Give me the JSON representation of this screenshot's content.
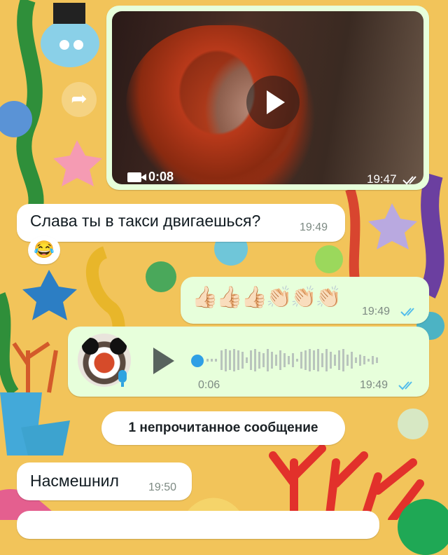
{
  "theme": {
    "out_bubble": "#e7ffdb",
    "in_bubble": "#ffffff",
    "read_ticks": "#53bdeb",
    "voice_progress": "#2f9fe5"
  },
  "forward": {
    "icon": "forward-arrow-icon"
  },
  "messages": {
    "video": {
      "duration": "0:08",
      "time": "19:47",
      "status": "read",
      "icon": "video-camera-icon"
    },
    "taxi": {
      "text": "Слава ты в такси двигаешься?",
      "time": "19:49",
      "reaction": "😂"
    },
    "emoji": {
      "text": "👍🏻👍🏻👍🏻👏🏻👏🏻👏🏻",
      "time": "19:49",
      "status": "read"
    },
    "voice": {
      "duration": "0:06",
      "time": "19:49",
      "status": "read",
      "icon": "microphone-icon"
    },
    "mocked": {
      "text": "Насмешнил",
      "time": "19:50"
    }
  },
  "unread_divider": {
    "text": "1 непрочитанное сообщение"
  }
}
